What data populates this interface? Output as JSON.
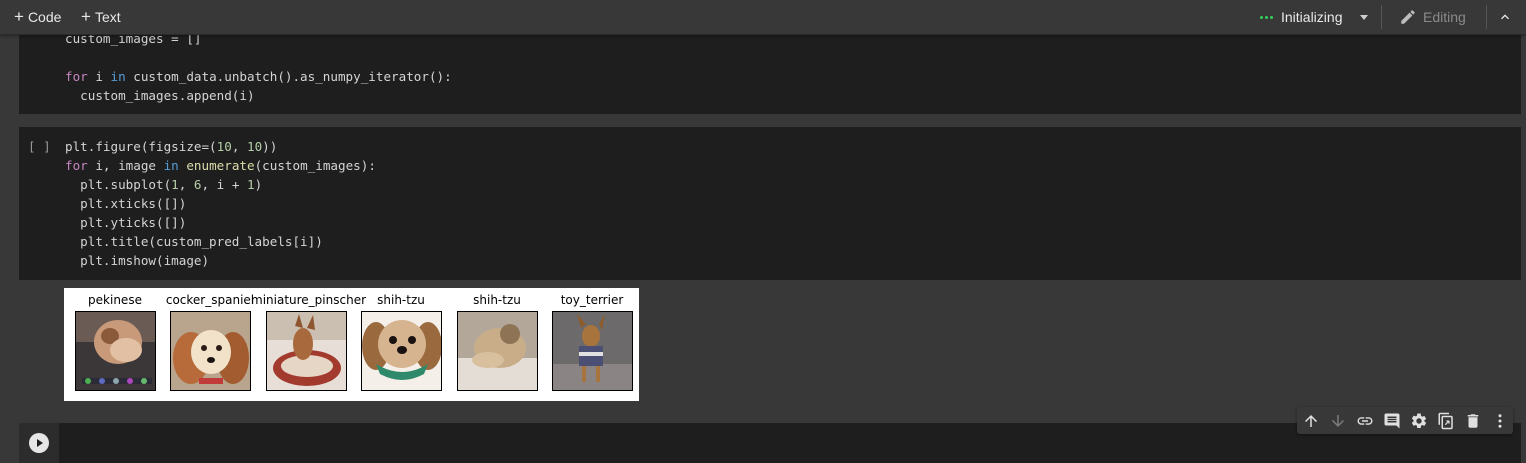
{
  "toolbar": {
    "code_label": "Code",
    "text_label": "Text",
    "status_label": "Initializing",
    "editing_label": "Editing",
    "status_color": "#34d058"
  },
  "cell1": {
    "lines": [
      "custom_images = []",
      "",
      "for i in custom_data.unbatch().as_numpy_iterator():",
      "  custom_images.append(i)"
    ]
  },
  "cell2": {
    "bracket": "[ ]",
    "lines": [
      "plt.figure(figsize=(10, 10))",
      "for i, image in enumerate(custom_images):",
      "  plt.subplot(1, 6, i + 1)",
      "  plt.xticks([])",
      "  plt.yticks([])",
      "  plt.title(custom_pred_labels[i])",
      "  plt.imshow(image)"
    ]
  },
  "output": {
    "subplots": [
      {
        "title": "pekinese",
        "icon": "dog-photo-icon"
      },
      {
        "title": "cocker_spaniel",
        "icon": "dog-photo-icon"
      },
      {
        "title": "miniature_pinscher",
        "icon": "dog-photo-icon"
      },
      {
        "title": "shih-tzu",
        "icon": "dog-photo-icon"
      },
      {
        "title": "shih-tzu",
        "icon": "dog-photo-icon"
      },
      {
        "title": "toy_terrier",
        "icon": "dog-photo-icon"
      }
    ]
  },
  "cell_toolbar": {
    "icons": [
      "arrow-up-icon",
      "arrow-down-icon",
      "link-icon",
      "comment-icon",
      "gear-icon",
      "mirror-cell-icon",
      "trash-icon",
      "more-vert-icon"
    ]
  }
}
